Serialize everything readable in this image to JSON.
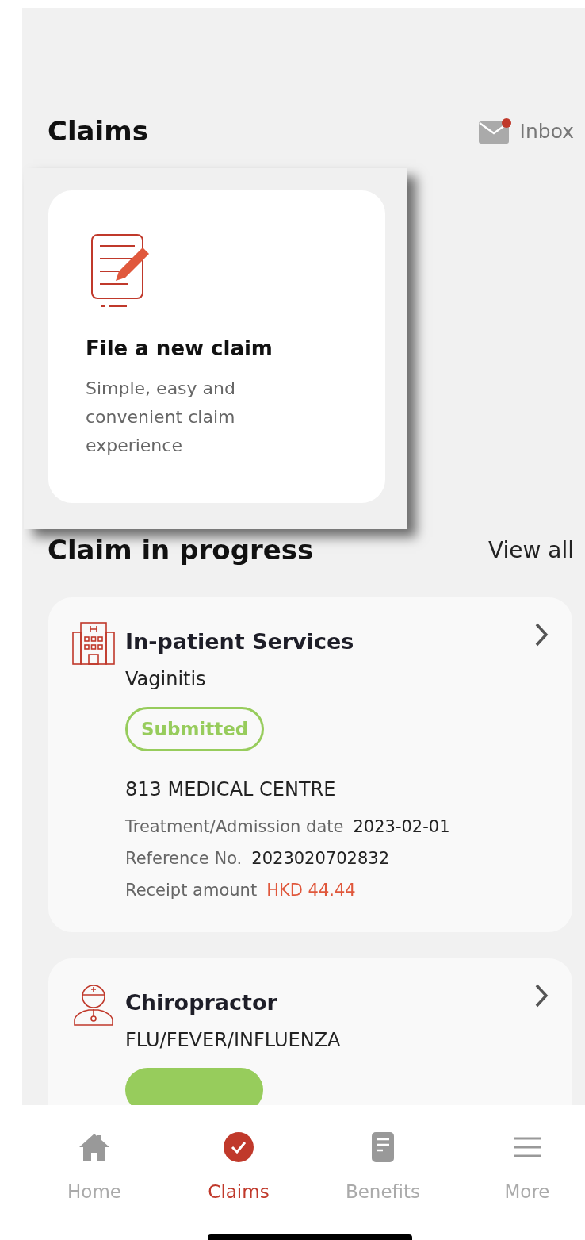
{
  "header": {
    "title": "Claims",
    "inbox": {
      "label": "Inbox",
      "unread": true
    }
  },
  "new_claim": {
    "title": "File a new claim",
    "description": "Simple, easy and convenient claim experience",
    "highlighted": true
  },
  "in_progress": {
    "title": "Claim in progress",
    "view_all": "View all"
  },
  "claims": [
    {
      "kind": "hospital",
      "service": "In-patient Services",
      "diagnosis": "Vaginitis",
      "status": {
        "label": "Submitted",
        "kind": "outline"
      },
      "provider": "813 MEDICAL CENTRE",
      "details": [
        {
          "label": "Treatment/Admission date",
          "value": "2023-02-01",
          "kind": "plain"
        },
        {
          "label": "Reference No.",
          "value": "2023020702832",
          "kind": "plain"
        },
        {
          "label": "Receipt amount",
          "value": "HKD 44.44",
          "kind": "amount"
        }
      ]
    },
    {
      "kind": "doctor",
      "service": "Chiropractor",
      "diagnosis": "FLU/FEVER/INFLUENZA",
      "status": {
        "kind": "filled"
      }
    }
  ],
  "tabs": [
    {
      "label": "Home",
      "kind": "home",
      "selected": false
    },
    {
      "label": "Claims",
      "kind": "check",
      "selected": true
    },
    {
      "label": "Benefits",
      "kind": "document",
      "selected": false
    },
    {
      "label": "More",
      "kind": "menu",
      "selected": false
    }
  ]
}
